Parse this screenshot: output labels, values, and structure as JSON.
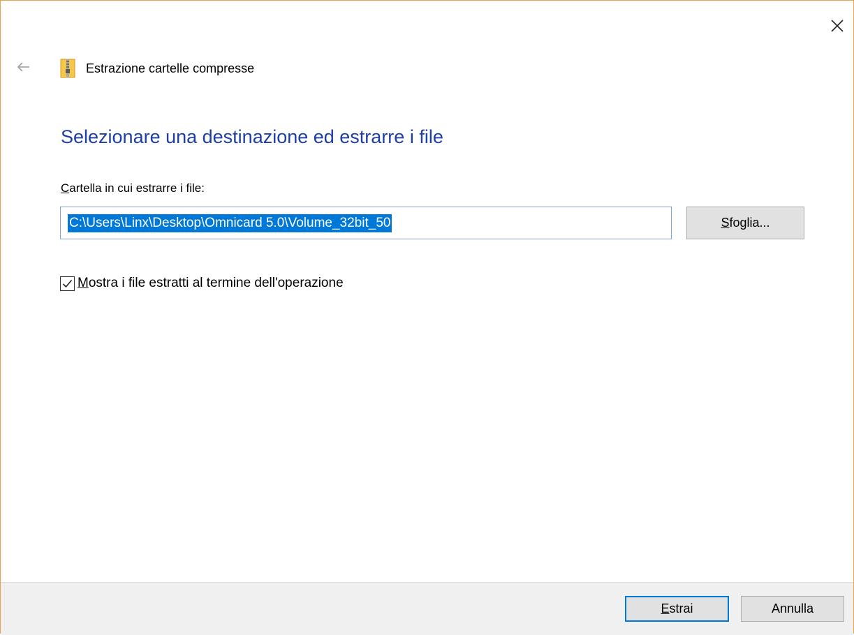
{
  "window": {
    "title": "Estrazione cartelle compresse",
    "accent_border_color": "#f0a24a"
  },
  "titlebar": {
    "close_icon": "close-icon",
    "back_icon": "back-arrow-icon"
  },
  "main": {
    "heading": "Selezionare una destinazione ed estrarre i file",
    "heading_color": "#1e3fa8",
    "destination": {
      "label_access_key": "C",
      "label_rest": "artella in cui estrarre i file:",
      "value": "C:\\Users\\Linx\\Desktop\\Omnicard 5.0\\Volume_32bit_50",
      "selected": true
    },
    "browse_button": {
      "access_key": "S",
      "rest": "foglia..."
    },
    "show_files_checkbox": {
      "checked": true,
      "label_access_key": "M",
      "label_rest": "ostra i file estratti al termine dell'operazione"
    }
  },
  "footer": {
    "extract_button": {
      "access_key": "E",
      "rest": "strai"
    },
    "cancel_button": {
      "label": "Annulla"
    }
  },
  "colors": {
    "selection": "#0078d7",
    "footer_bg": "#f0f0f0",
    "button_bg": "#e1e1e1"
  }
}
